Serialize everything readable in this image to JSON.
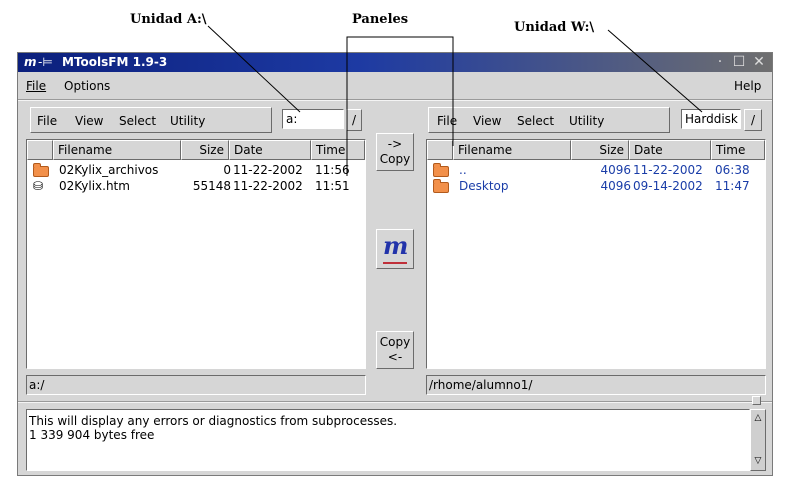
{
  "annotations": {
    "drive_a": "Unidad A:\\",
    "panels": "Paneles",
    "drive_w": "Unidad W:\\"
  },
  "window": {
    "title": "MToolsFM 1.9-3",
    "app_icon": "m",
    "pin_icon": "pin-icon"
  },
  "menubar": {
    "file": "File",
    "options": "Options",
    "help": "Help"
  },
  "left_panel": {
    "menu": [
      "File",
      "View",
      "Select",
      "Utility"
    ],
    "drive_value": "a:",
    "slash_button": "/",
    "columns": [
      "Filename",
      "Size",
      "Date",
      "Time"
    ],
    "rows": [
      {
        "icon": "folder",
        "name": "02Kylix_archivos",
        "size": "0",
        "date": "11-22-2002",
        "time": "11:56"
      },
      {
        "icon": "file",
        "name": "02Kylix.htm",
        "size": "55148",
        "date": "11-22-2002",
        "time": "11:51"
      }
    ],
    "status_path": "a:/"
  },
  "center": {
    "copy_right_arrow": "->",
    "copy_right_label": "Copy",
    "logo": "m",
    "copy_left_label": "Copy",
    "copy_left_arrow": "<-"
  },
  "right_panel": {
    "menu": [
      "File",
      "View",
      "Select",
      "Utility"
    ],
    "drive_value": "Harddisk",
    "slash_button": "/",
    "columns": [
      "Filename",
      "Size",
      "Date",
      "Time"
    ],
    "rows": [
      {
        "icon": "folder",
        "name": "..",
        "size": "4096",
        "date": "11-22-2002",
        "time": "06:38"
      },
      {
        "icon": "folder",
        "name": "Desktop",
        "size": "4096",
        "date": "09-14-2002",
        "time": "11:47"
      }
    ],
    "status_path": "/rhome/alumno1/"
  },
  "log": {
    "lines": [
      "This will display any errors or diagnostics from subprocesses.",
      "1 339 904 bytes free"
    ]
  },
  "colors": {
    "title_bar": "#0b1f7c",
    "folder": "#f2904a",
    "right_list_text": "#1a3da8"
  }
}
